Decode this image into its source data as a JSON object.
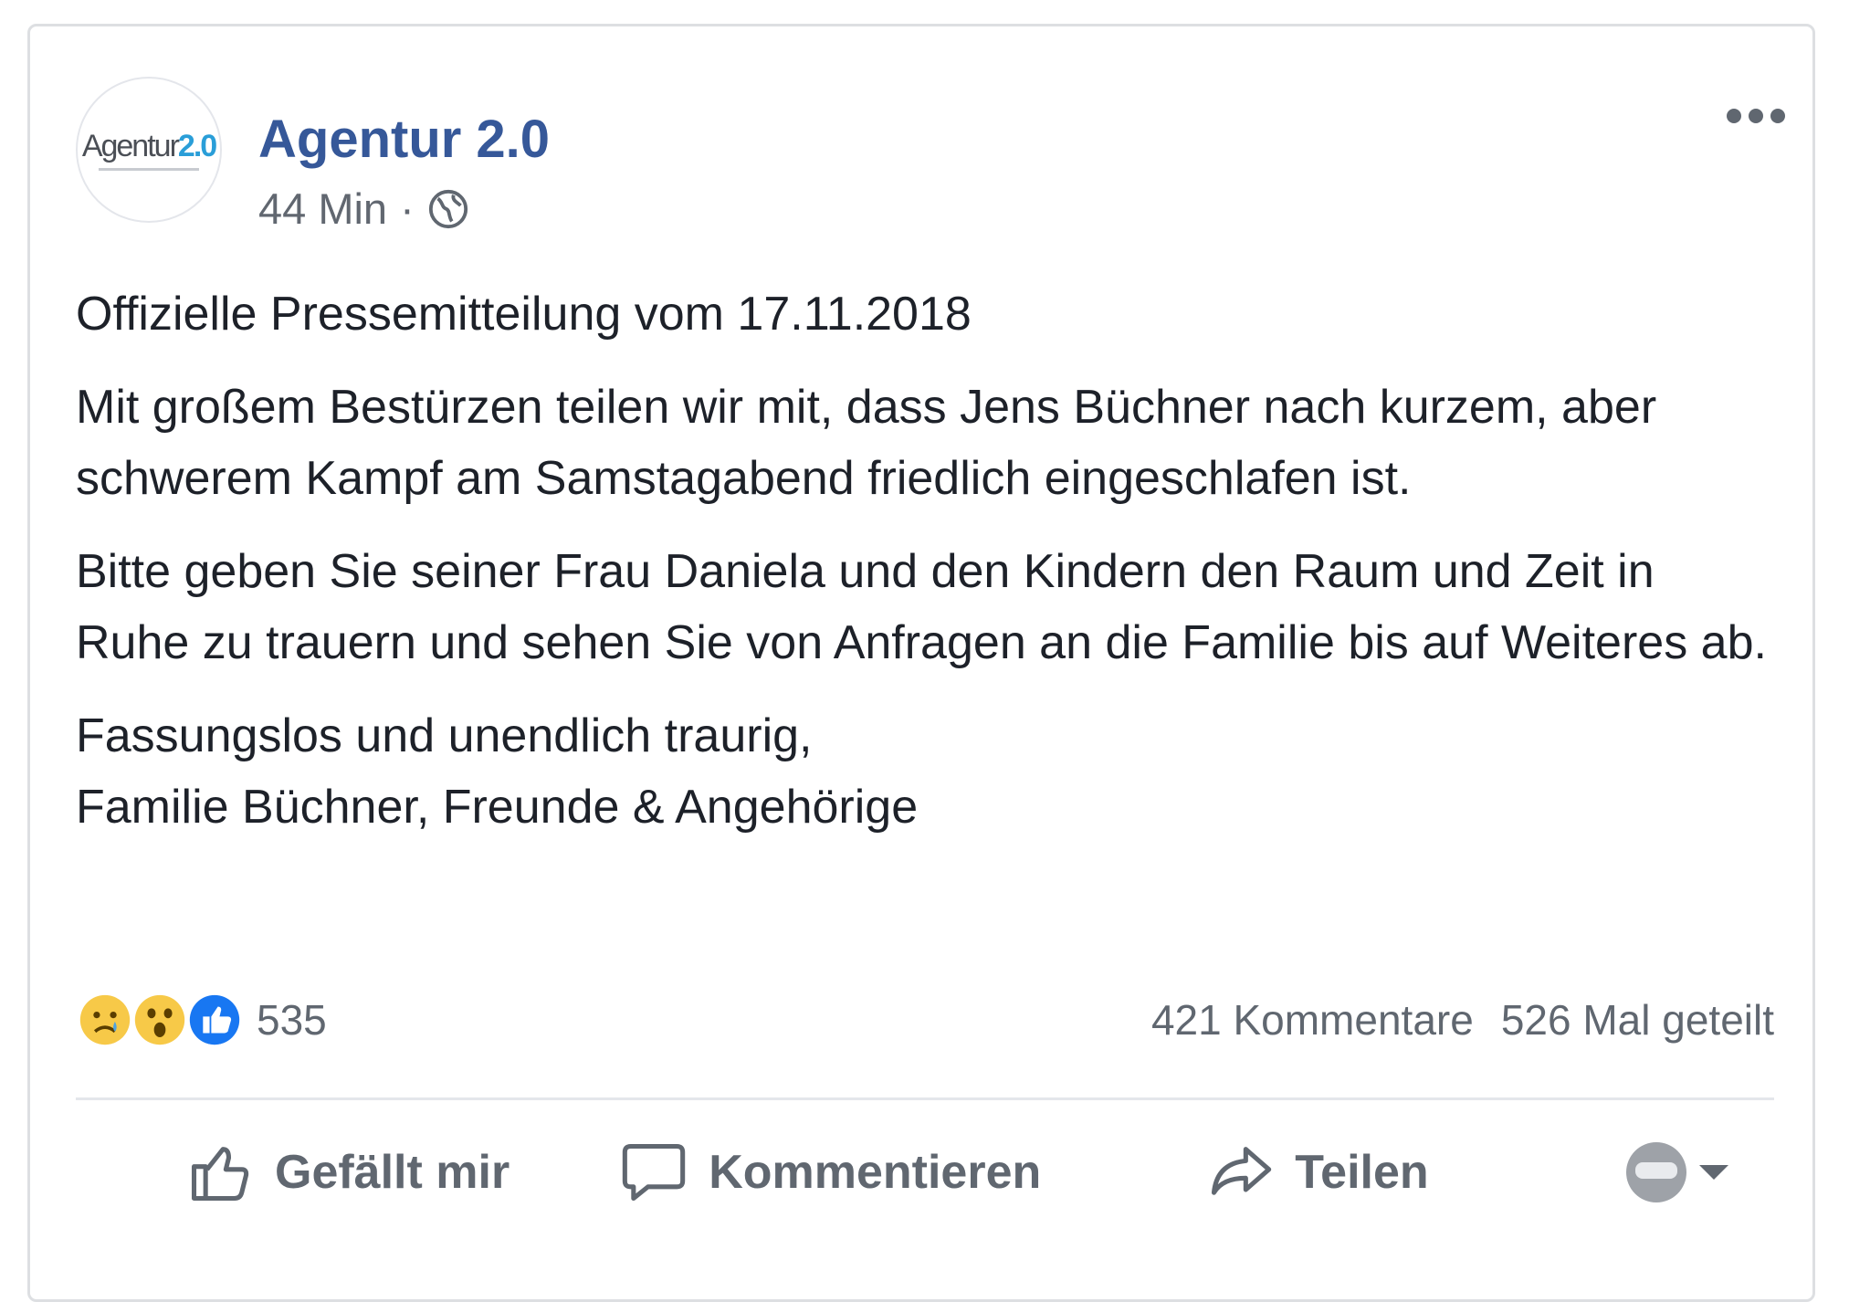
{
  "post": {
    "page_name": "Agentur 2.0",
    "avatar_logo": "Agentur2.0",
    "timestamp": "44 Min",
    "separator": "·",
    "privacy_icon": "globe-icon",
    "paragraphs": [
      "Offizielle Pressemitteilung vom 17.11.2018",
      "Mit großem Bestürzen teilen wir mit, dass Jens Büchner nach kurzem, aber schwerem Kampf am Samstagabend friedlich eingeschlafen ist.",
      "Bitte geben Sie seiner Frau Daniela und den Kindern den Raum und Zeit in Ruhe zu trauern und sehen Sie von Anfragen an die Familie bis auf Weiteres ab.",
      "Fassungslos und unendlich traurig,",
      "Familie Büchner, Freunde & Angehörige"
    ]
  },
  "stats": {
    "reactions": [
      "sad-icon",
      "wow-icon",
      "like-icon"
    ],
    "reaction_count": "535",
    "comments": "421 Kommentare",
    "shares": "526 Mal geteilt"
  },
  "actions": {
    "like_label": "Gefällt mir",
    "comment_label": "Kommentieren",
    "share_label": "Teilen"
  },
  "colors": {
    "brand": "#365899",
    "like_blue": "#1877f2",
    "text_secondary": "#606770"
  }
}
